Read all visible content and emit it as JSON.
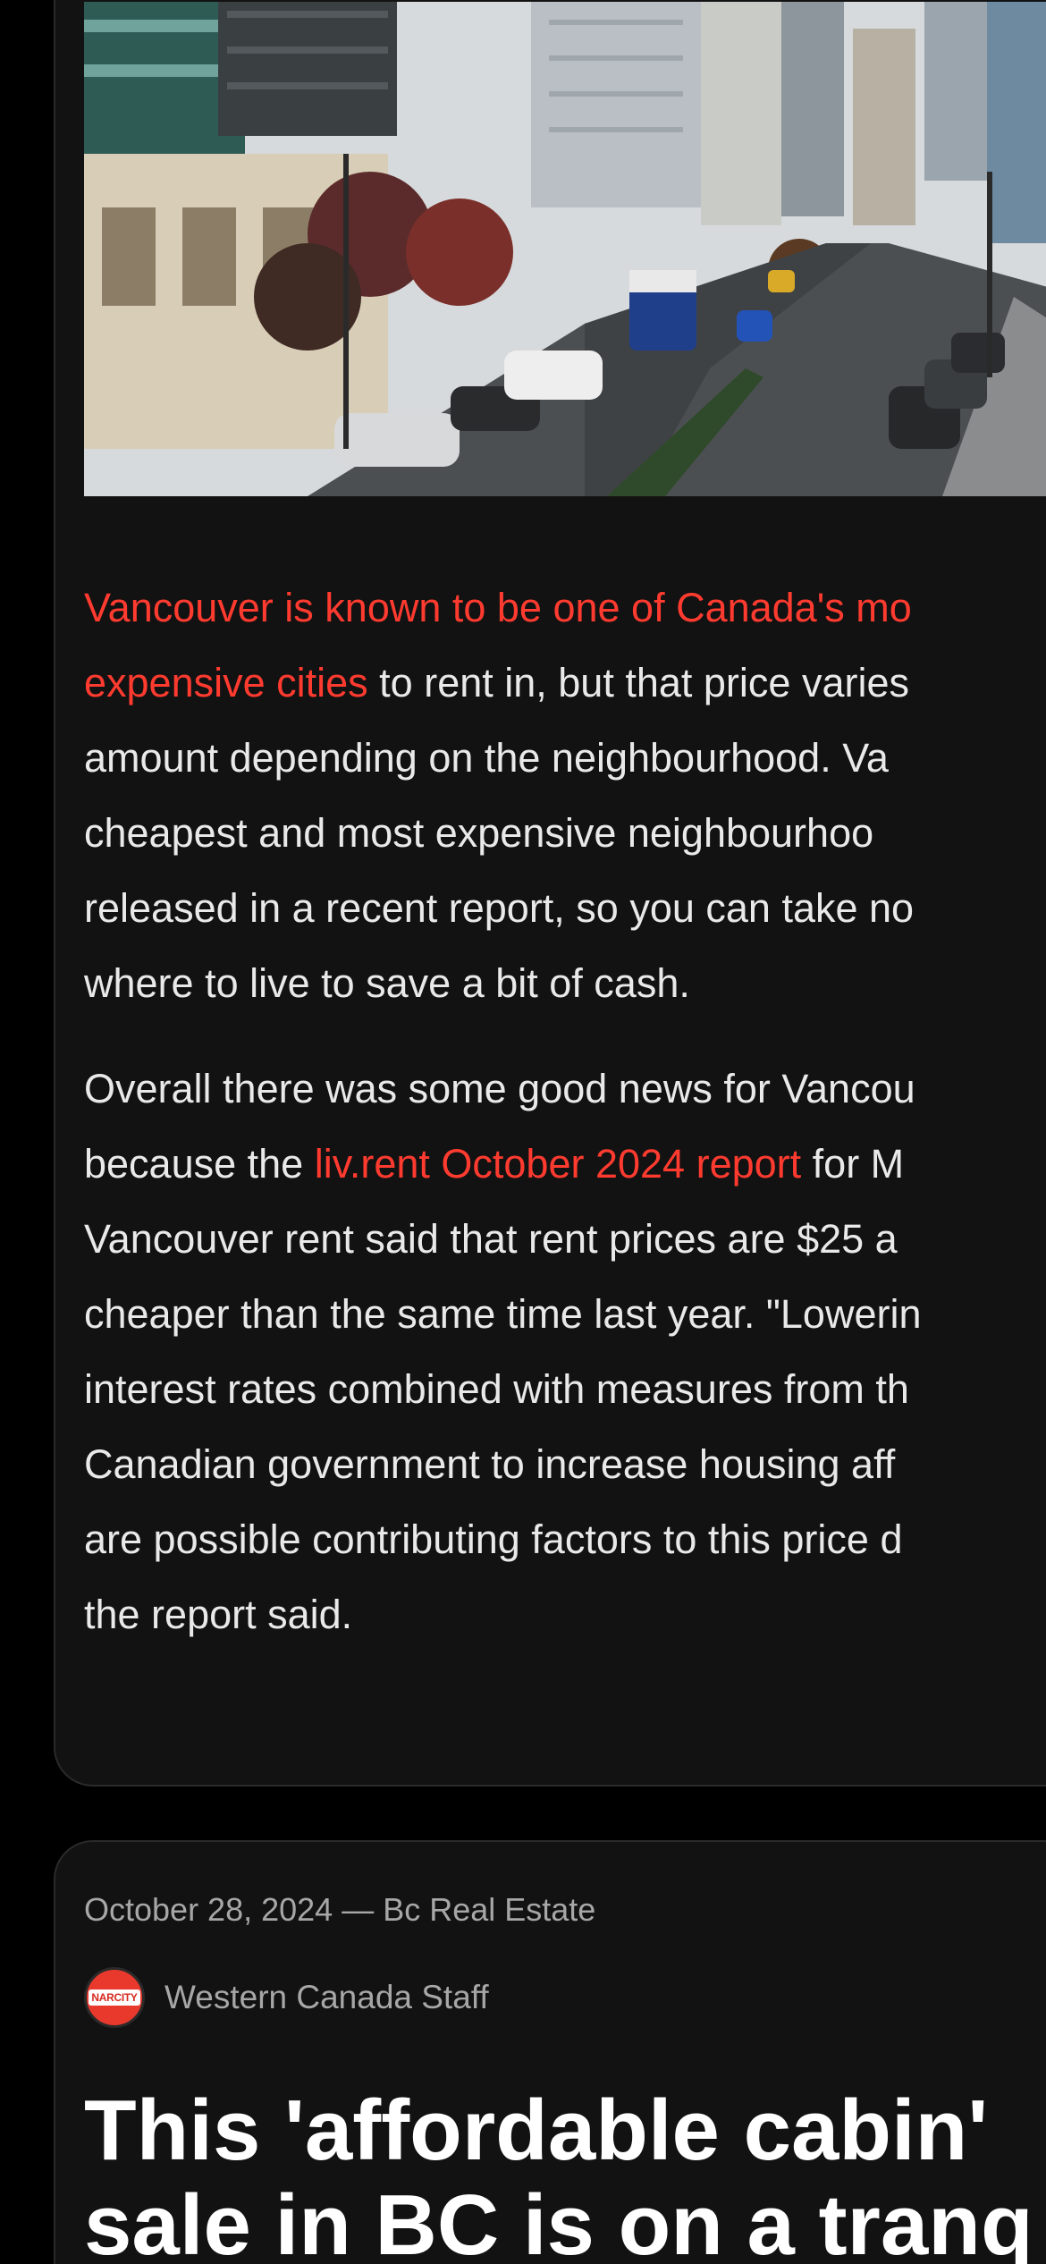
{
  "article_1": {
    "photo_alt": "Vancouver street with downtown towers",
    "paragraph_1": {
      "line_1": {
        "link": "Vancouver is known to be one of Canada's mo"
      },
      "line_2": {
        "link": "expensive cities",
        "text": " to rent in, but that price varies"
      },
      "line_3": "amount depending on the neighbourhood. Va",
      "line_4": "cheapest and most expensive neighbourhoo",
      "line_5": "released in a recent report, so you can take no",
      "line_6": "where to live to save a bit of cash."
    },
    "paragraph_2": {
      "line_1": "Overall there was some good news for Vancou",
      "line_2": {
        "before": "because the ",
        "link": "liv.rent October 2024 report",
        "after": " for M"
      },
      "line_3": "Vancouver rent said that rent prices are $25 a",
      "line_4": "cheaper than the same time last year. \"Lowerin",
      "line_5": "interest rates combined with measures from th",
      "line_6": "Canadian government to increase housing aff",
      "line_7": "are possible contributing factors to this price d",
      "line_8": "the report said."
    }
  },
  "article_2": {
    "date": "October 28, 2024",
    "separator": " — ",
    "category": "Bc Real Estate",
    "avatar_label": "NARCITY",
    "author": "Western Canada Staff",
    "headline_line_1": "This 'affordable cabin'",
    "headline_line_2": "sale in BC is on a tranq"
  },
  "colors": {
    "background": "#000000",
    "card": "#121212",
    "text": "#e9e9e9",
    "link": "#ff3b30",
    "meta": "#a7a7a7",
    "brand": "#e9392c"
  }
}
